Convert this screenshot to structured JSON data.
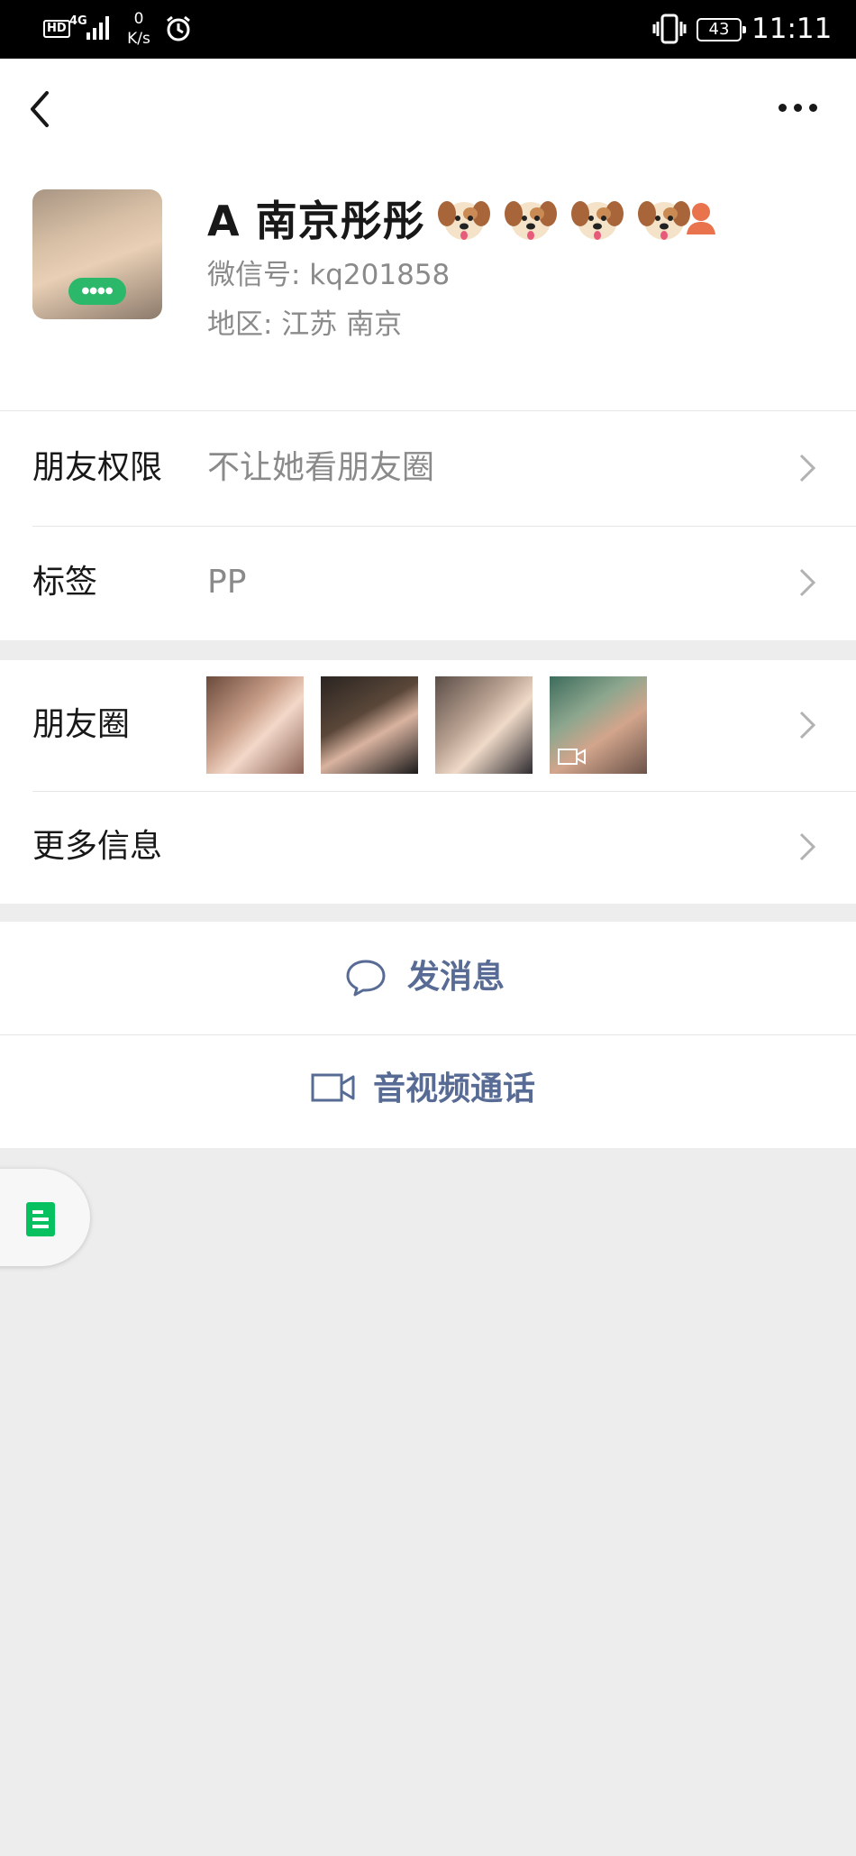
{
  "status_bar": {
    "hd": "HD",
    "network": "4G",
    "speed_value": "0",
    "speed_unit": "K/s",
    "battery": "43",
    "time": "11:11"
  },
  "profile": {
    "name": "A 南京彤彤",
    "name_emojis": [
      "dog-face",
      "dog-face",
      "dog-face",
      "dog-face"
    ],
    "wechat_id": "微信号: kq201858",
    "region": "地区: 江苏  南京"
  },
  "rows": {
    "friend_permissions": {
      "label": "朋友权限",
      "value": "不让她看朋友圈"
    },
    "tags": {
      "label": "标签",
      "value": "PP"
    },
    "moments": {
      "label": "朋友圈",
      "thumbnail_count": 4
    },
    "more_info": {
      "label": "更多信息"
    }
  },
  "actions": {
    "send_message": "发消息",
    "video_call": "音视频通话"
  },
  "colors": {
    "action_text": "#576b95",
    "star_friend": "#e8734d",
    "float_icon": "#07c160"
  },
  "icons": [
    "back-icon",
    "more-icon",
    "chevron-right-icon",
    "chat-bubble-icon",
    "video-camera-icon",
    "document-icon",
    "star-friend-icon"
  ]
}
